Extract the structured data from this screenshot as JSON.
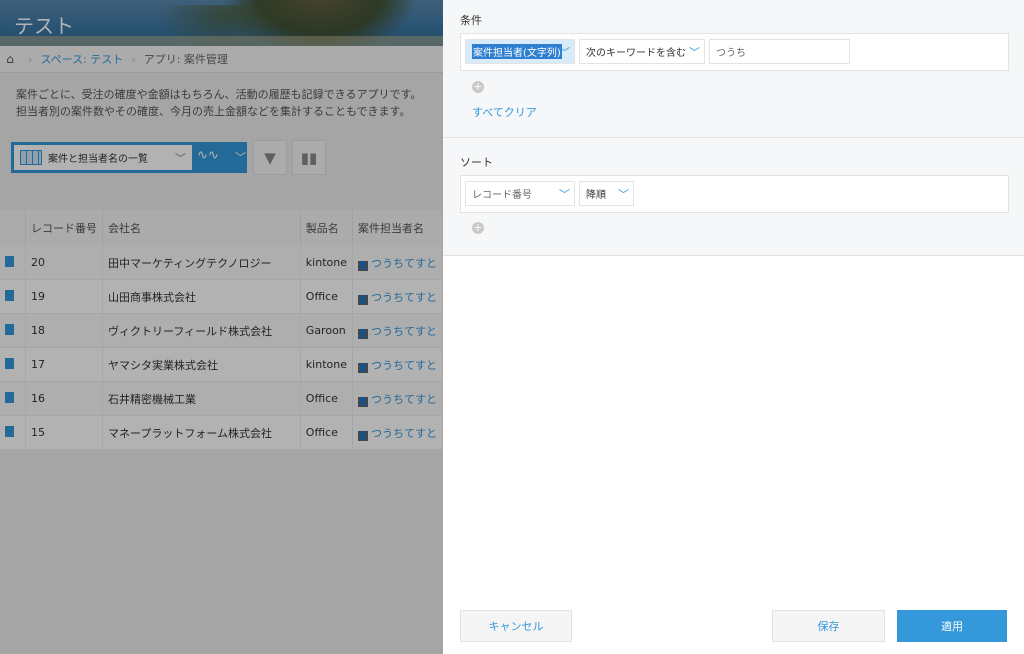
{
  "app": {
    "title": "テスト",
    "breadcrumb": [
      "スペース: テスト",
      "アプリ: 案件管理"
    ],
    "description": [
      "案件ごとに、受注の確度や金額はもちろん、活動の履歴も記録できるアプリです。",
      "担当者別の案件数やその確度、今月の売上金額などを集計することもできます。"
    ],
    "view_name": "案件と担当者名の一覧"
  },
  "table": {
    "headers": [
      "レコード番号",
      "会社名",
      "製品名",
      "案件担当者名"
    ],
    "rows": [
      {
        "id": "20",
        "company": "田中マーケティングテクノロジー",
        "product": "kintone",
        "person": "つうちてすと"
      },
      {
        "id": "19",
        "company": "山田商事株式会社",
        "product": "Office",
        "person": "つうちてすと"
      },
      {
        "id": "18",
        "company": "ヴィクトリーフィールド株式会社",
        "product": "Garoon",
        "person": "つうちてすと"
      },
      {
        "id": "17",
        "company": "ヤマシタ実業株式会社",
        "product": "kintone",
        "person": "つうちてすと"
      },
      {
        "id": "16",
        "company": "石井精密機械工業",
        "product": "Office",
        "person": "つうちてすと"
      },
      {
        "id": "15",
        "company": "マネープラットフォーム株式会社",
        "product": "Office",
        "person": "つうちてすと"
      }
    ]
  },
  "panel": {
    "condition": {
      "title": "条件",
      "field": "案件担当者(文字列)",
      "operator": "次のキーワードを含む",
      "value": "つうち",
      "clear_all": "すべてクリア"
    },
    "sort": {
      "title": "ソート",
      "field": "レコード番号",
      "order": "降順"
    },
    "buttons": {
      "cancel": "キャンセル",
      "save": "保存",
      "apply": "適用"
    }
  }
}
